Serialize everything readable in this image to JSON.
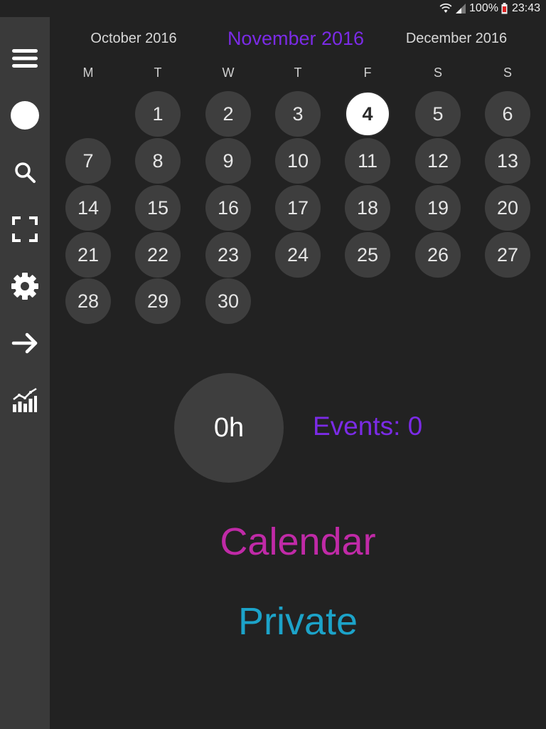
{
  "status_bar": {
    "battery": "100%",
    "time": "23:43"
  },
  "sidebar": {
    "items": [
      {
        "icon": "menu-icon"
      },
      {
        "icon": "circle-icon"
      },
      {
        "icon": "search-icon"
      },
      {
        "icon": "fullscreen-icon"
      },
      {
        "icon": "gear-icon"
      },
      {
        "icon": "arrow-right-icon"
      },
      {
        "icon": "stats-icon"
      }
    ]
  },
  "header": {
    "prev_month": "October 2016",
    "current_month": "November 2016",
    "next_month": "December 2016"
  },
  "weekdays": [
    "M",
    "T",
    "W",
    "T",
    "F",
    "S",
    "S"
  ],
  "calendar": {
    "days": [
      "1",
      "2",
      "3",
      "4",
      "5",
      "6",
      "7",
      "8",
      "9",
      "10",
      "11",
      "12",
      "13",
      "14",
      "15",
      "16",
      "17",
      "18",
      "19",
      "20",
      "21",
      "22",
      "23",
      "24",
      "25",
      "26",
      "27",
      "28",
      "29",
      "30"
    ],
    "first_weekday_index": 1,
    "today": "4"
  },
  "summary": {
    "hours": "0h",
    "events": "Events: 0"
  },
  "calendars": [
    {
      "name": "Calendar",
      "color": "#c02aa7"
    },
    {
      "name": "Private",
      "color": "#1ca3c9"
    }
  ],
  "colors": {
    "accent": "#7b2be6",
    "background": "#222222",
    "sidebar": "#3a3a3a",
    "day_circle": "#3e3e3e"
  }
}
